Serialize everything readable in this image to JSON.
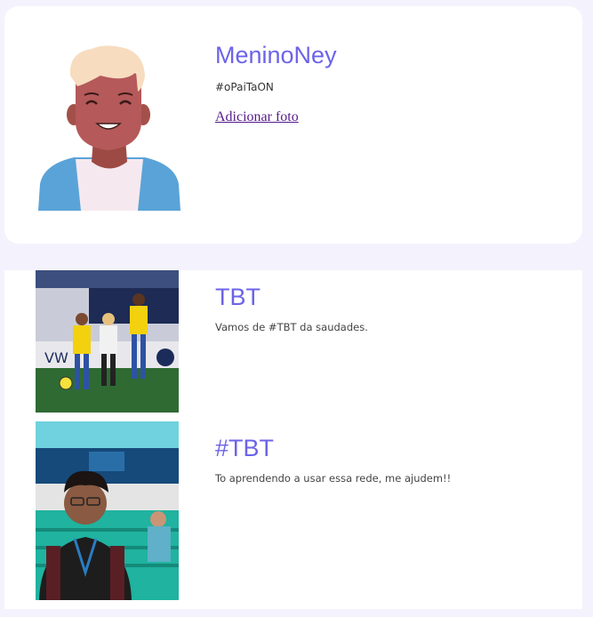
{
  "profile": {
    "name": "MeninoNey",
    "tag": "#oPaiTaON",
    "add_photo_label": "Adicionar foto"
  },
  "posts": [
    {
      "title": "TBT",
      "caption": "Vamos de #TBT da saudades."
    },
    {
      "title": "#TBT",
      "caption": "To aprendendo a usar essa rede, me ajudem!!"
    }
  ],
  "colors": {
    "page_background": "#f4f3fd",
    "accent": "#6c63e8",
    "link": "#551a8b",
    "card": "#ffffff"
  }
}
